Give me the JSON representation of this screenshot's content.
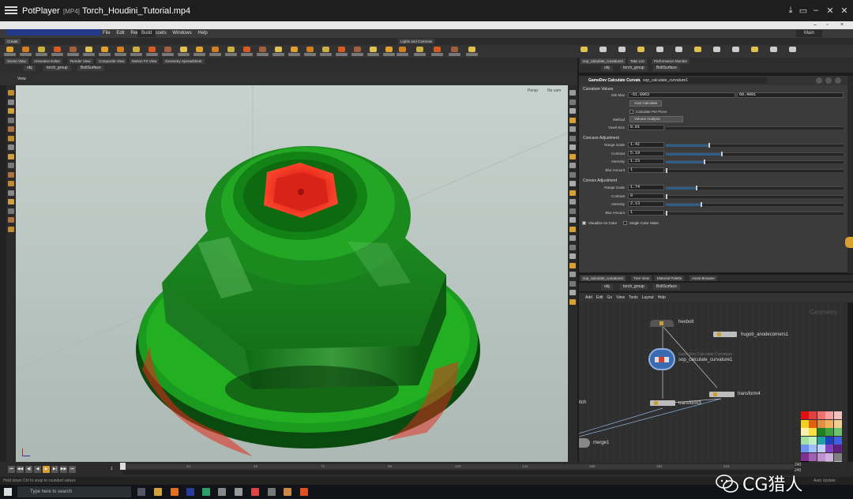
{
  "player": {
    "app_name": "PotPlayer",
    "format": "[MP4]",
    "file_name": "Torch_Houdini_Tutorial.mp4",
    "controls": [
      "⤓",
      "▭",
      "–",
      "✕",
      "✕"
    ]
  },
  "houdini": {
    "menu_items": [
      "File",
      "Edit",
      "Render",
      "Assets",
      "Windows",
      "Help"
    ],
    "desktop_tabs": {
      "build": "Build",
      "main": "Main"
    },
    "shelf_sets": {
      "left": "Create",
      "lights_cameras": "Lights and Cameras"
    },
    "pane_tabs_top": [
      "Scene View",
      "Animation Editor",
      "Render View",
      "Composite View",
      "Motion FX View",
      "Geometry Spreadsheet"
    ],
    "path": {
      "obj": "obj",
      "geo": "torch_group",
      "node": "BoltSurface"
    },
    "viewport": {
      "title": "View",
      "persp": "Persp",
      "cam": "No cam"
    },
    "param_tabs": [
      "sop_calculate_curvature1",
      "Take List",
      "Performance Monitor"
    ],
    "param_header": {
      "type": "GameDev Calculate Curvature",
      "node_name": "sop_calculate_curvature1"
    },
    "params": {
      "section_curvature_values": "Curvature Values",
      "min_max_label": "Min Max",
      "min_value": "-61.8963",
      "max_value": "60.4091",
      "auto_calculate": "Auto Calculate",
      "calculate_per_piece": "Calculate Per Piece",
      "method_label": "Method",
      "method_value": "Volume Analysis",
      "voxel_size_label": "Voxel Size",
      "voxel_size_value": "0.01",
      "section_concave": "Concave Adjustment",
      "section_convex": "Convex Adjustment",
      "range_scale_label": "Range Scale",
      "contrast_label": "Contrast",
      "intensity_label": "Intensity",
      "blur_label": "Blur Amount",
      "concave": {
        "range_scale": "1.42",
        "contrast": "5.19",
        "intensity": "1.23",
        "blur": "1"
      },
      "convex": {
        "range_scale": "1.74",
        "contrast": "0",
        "intensity": "2.13",
        "blur": "1"
      },
      "visualize_as_color": "Visualize As Color",
      "single_color_value": "Single Color Value"
    },
    "network_tabs": [
      "sop_calculate_curvature1",
      "Tree View",
      "Material Palette",
      "Asset Browser"
    ],
    "network_menu": [
      "Add",
      "Edit",
      "Go",
      "View",
      "Tools",
      "Layout",
      "Help"
    ],
    "network_title": "Geometry",
    "nodes": {
      "hexbolt": "hexbolt",
      "edge_node": "hugob_anodecorners1",
      "curvature": "sop_calculate_curvature1",
      "curvature_type": "GameDev Calculate Curvature",
      "transform3": "transform3",
      "transform4": "transform4",
      "merge": "merge1",
      "partial": "itch"
    },
    "timeline": {
      "ticks": [
        "24",
        "48",
        "72",
        "96",
        "120",
        "144",
        "168",
        "192",
        "216"
      ],
      "start": "1",
      "end_a": "240",
      "end_b": "240"
    },
    "status_text": "Hold down Ctrl to snap to rounded values",
    "auto_update": "Auto Update"
  },
  "taskbar": {
    "search_placeholder": "Type here to search"
  },
  "watermark": "CG猎人",
  "colors": {
    "viewport_bg": "#c0cbc7",
    "bolt_green": "#22b022",
    "bolt_red": "#e62a1a",
    "accent_blue": "#2f5f88"
  }
}
